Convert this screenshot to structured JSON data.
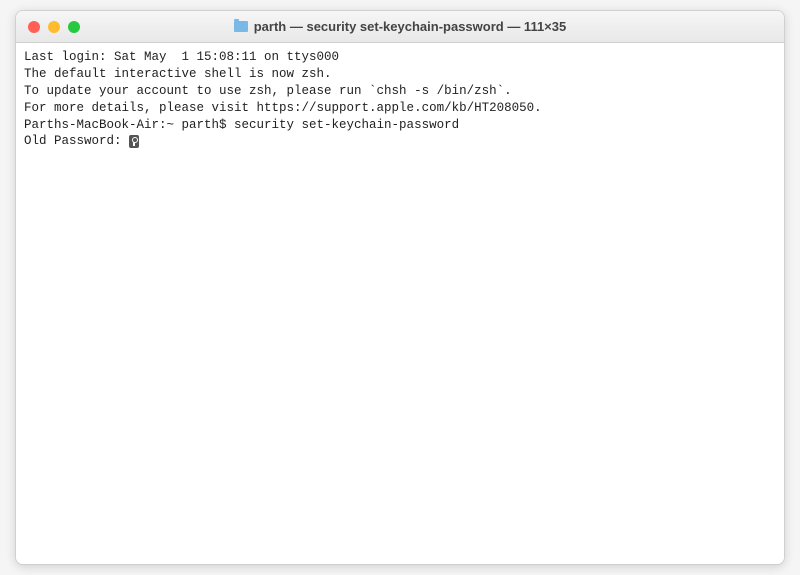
{
  "window": {
    "title": "parth — security set-keychain-password — 111×35"
  },
  "terminal": {
    "lines": {
      "last_login": "Last login: Sat May  1 15:08:11 on ttys000",
      "blank1": "",
      "zsh_msg1": "The default interactive shell is now zsh.",
      "zsh_msg2": "To update your account to use zsh, please run `chsh -s /bin/zsh`.",
      "zsh_msg3": "For more details, please visit https://support.apple.com/kb/HT208050.",
      "prompt_line": "Parths-MacBook-Air:~ parth$ security set-keychain-password",
      "old_password_label": "Old Password: "
    }
  }
}
